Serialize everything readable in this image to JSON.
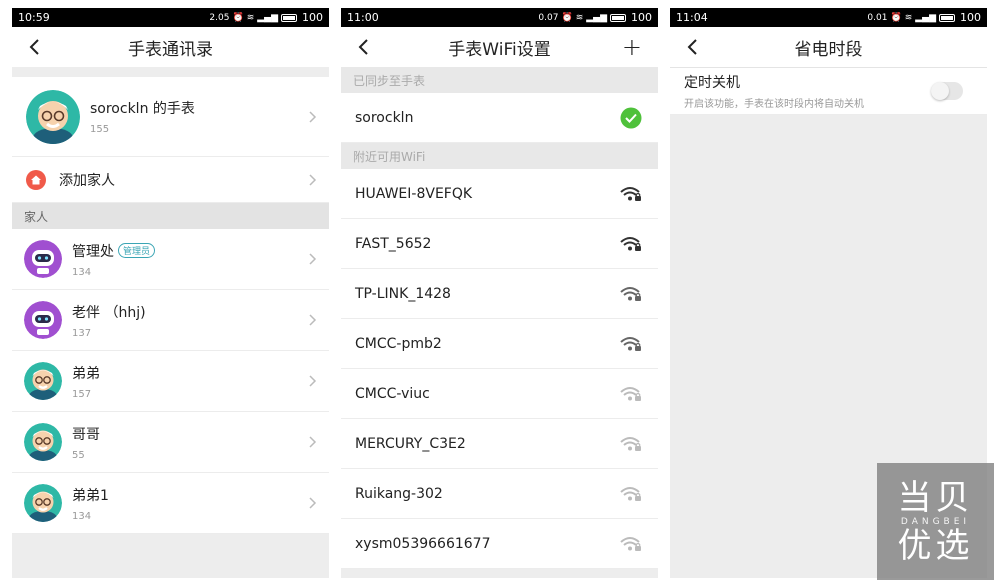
{
  "panel1": {
    "status": {
      "time": "10:59",
      "speed": "2.05",
      "battery": "100"
    },
    "title": "手表通讯录",
    "watch": {
      "name": "sorockln 的手表",
      "phone": "155"
    },
    "add_family": "添加家人",
    "section_label": "家人",
    "admin_badge": "管理员",
    "contacts": [
      {
        "name": "管理处",
        "phone": "134",
        "avatar": "robot-avatar",
        "admin": true
      },
      {
        "name": "老伴 （hhj)",
        "phone": "137",
        "avatar": "robot-avatar",
        "admin": false
      },
      {
        "name": "弟弟",
        "phone": "157",
        "avatar": "grandpa-avatar",
        "admin": false
      },
      {
        "name": "哥哥",
        "phone": "55",
        "avatar": "grandpa-avatar",
        "admin": false
      },
      {
        "name": "弟弟1",
        "phone": "134",
        "avatar": "grandpa-avatar",
        "admin": false
      }
    ]
  },
  "panel2": {
    "status": {
      "time": "11:00",
      "speed": "0.07",
      "battery": "100"
    },
    "title": "手表WiFi设置",
    "synced_label": "已同步至手表",
    "synced_network": "sorockln",
    "nearby_label": "附近可用WiFi",
    "networks": [
      {
        "ssid": "HUAWEI-8VEFQK",
        "signal": "strong"
      },
      {
        "ssid": "FAST_5652",
        "signal": "strong"
      },
      {
        "ssid": "TP-LINK_1428",
        "signal": "medium"
      },
      {
        "ssid": "CMCC-pmb2",
        "signal": "medium"
      },
      {
        "ssid": "CMCC-viuc",
        "signal": "weak"
      },
      {
        "ssid": "MERCURY_C3E2",
        "signal": "weak"
      },
      {
        "ssid": "Ruikang-302",
        "signal": "weak"
      },
      {
        "ssid": "xysm05396661677",
        "signal": "weak"
      }
    ]
  },
  "panel3": {
    "status": {
      "time": "11:04",
      "speed": "0.01",
      "battery": "100"
    },
    "title": "省电时段",
    "setting_title": "定时关机",
    "setting_desc": "开启该功能，手表在该时段内将自动关机",
    "toggle_on": false
  },
  "watermark": {
    "line1": "当贝",
    "line2": "DANGBEI",
    "line3": "优选"
  },
  "colors": {
    "accent": "#3aa5b4",
    "check": "#4fc13b",
    "home_icon": "#f05a4a",
    "robot": "#a04fd0"
  }
}
